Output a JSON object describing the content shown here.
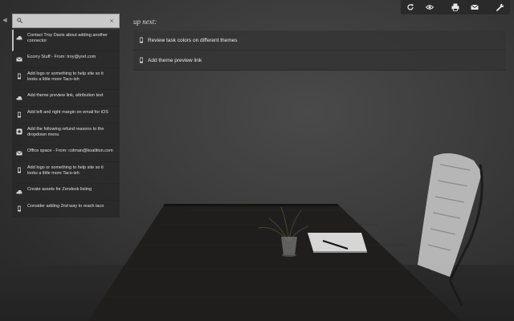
{
  "toolbar": {
    "buttons": [
      {
        "icon": "refresh-icon"
      },
      {
        "icon": "eye-icon"
      },
      {
        "icon": "print-icon"
      },
      {
        "icon": "mail-icon"
      },
      {
        "icon": "wrench-icon"
      }
    ]
  },
  "side_toggle": {
    "glyph": "◀"
  },
  "search": {
    "value": "",
    "placeholder": "",
    "clear_glyph": "×"
  },
  "tasks": [
    {
      "icon": "cloud-icon",
      "text": "Contact Troy Davis about adding another connector"
    },
    {
      "icon": "mail-icon",
      "text": "Ecorry Stuff - From: troy@yort.com"
    },
    {
      "icon": "phone-icon",
      "text": "Add logo or something to help site so it looks a little more Taco-ish"
    },
    {
      "icon": "cloud-icon",
      "text": "Add theme preview link, attribution text"
    },
    {
      "icon": "phone-icon",
      "text": "Add left and right margin on email for iOS"
    },
    {
      "icon": "app-icon",
      "text": "Add the following refund reasons to the dropdown menu"
    },
    {
      "icon": "mail-icon",
      "text": "Office space - From: colman@koalition.com"
    },
    {
      "icon": "phone-icon",
      "text": "Add logo or something to help site so it looks a little more Taco-ish"
    },
    {
      "icon": "cloud-icon",
      "text": "Create assets for Zendesk listing"
    },
    {
      "icon": "phone-icon",
      "text": "Consider adding 2nd way to reach taco"
    }
  ],
  "up_next": {
    "heading": "up next:",
    "items": [
      {
        "icon": "phone-icon",
        "text": "Review task colors on different themes"
      },
      {
        "icon": "phone-icon",
        "text": "Add theme preview link"
      }
    ]
  }
}
